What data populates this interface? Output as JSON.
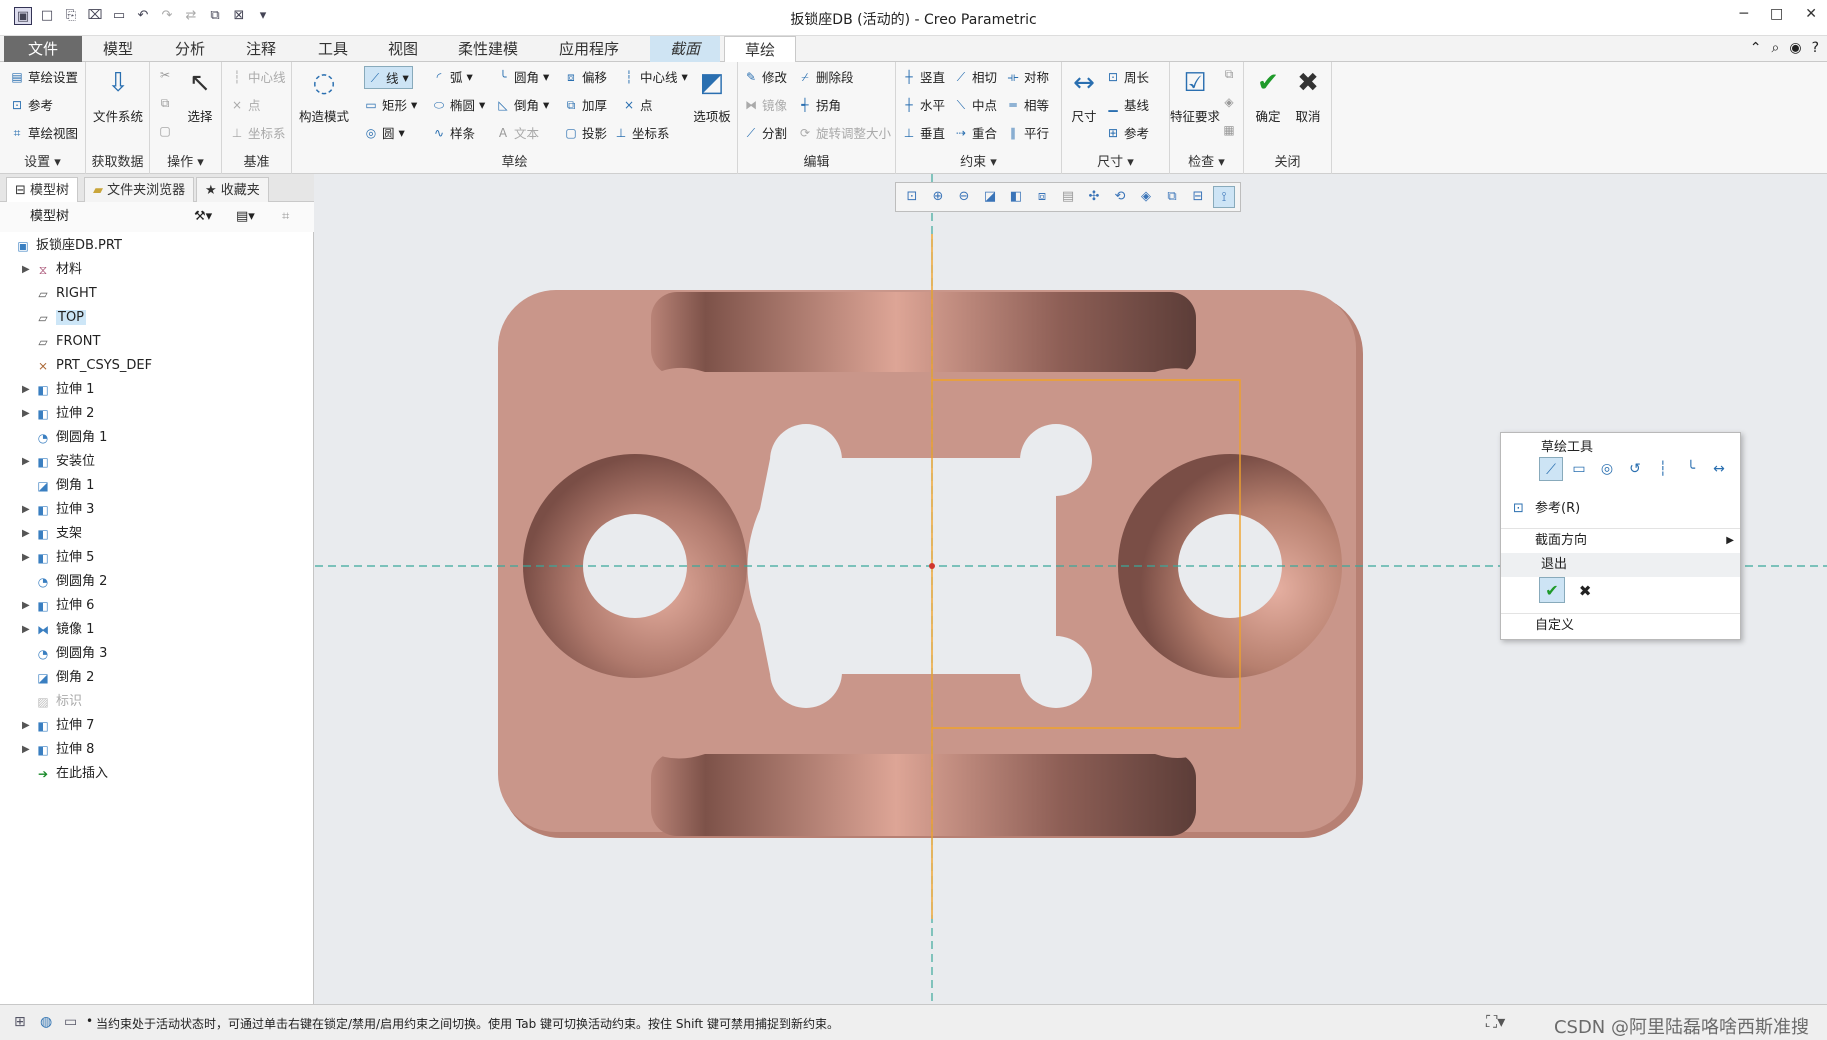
{
  "window": {
    "title": "扳锁座DB (活动的) - Creo Parametric"
  },
  "qat_icons": [
    "app-icon",
    "new-icon",
    "open-icon",
    "save-icon",
    "undo-icon",
    "redo-icon",
    "regenerate-icon",
    "windows-icon",
    "close-icon",
    "customize-icon"
  ],
  "tabs": [
    {
      "label": "文件"
    },
    {
      "label": "模型"
    },
    {
      "label": "分析"
    },
    {
      "label": "注释"
    },
    {
      "label": "工具"
    },
    {
      "label": "视图"
    },
    {
      "label": "柔性建模"
    },
    {
      "label": "应用程序"
    },
    {
      "label": "截面"
    },
    {
      "label": "草绘"
    }
  ],
  "ribbon": {
    "setup": {
      "sketch_setup": "草绘设置",
      "reference": "参考",
      "sketch_view": "草绘视图",
      "label": "设置"
    },
    "get_data": {
      "file_system": "文件系统",
      "label": "获取数据"
    },
    "operations": {
      "select": "选择",
      "label": "操作"
    },
    "datum": {
      "centerline": "中心线",
      "point": "点",
      "csys": "坐标系",
      "label": "基准"
    },
    "sketching": {
      "construction": "构造模式",
      "line": "线",
      "arc": "弧",
      "fillet": "圆角",
      "offset": "偏移",
      "centerline": "中心线",
      "rectangle": "矩形",
      "ellipse": "椭圆",
      "chamfer": "倒角",
      "thicken": "加厚",
      "point": "点",
      "circle": "圆",
      "spline": "样条",
      "text": "文本",
      "project": "投影",
      "csys": "坐标系",
      "palette": "选项板",
      "label": "草绘"
    },
    "editing": {
      "modify": "修改",
      "delete_segment": "删除段",
      "mirror": "镜像",
      "corner": "拐角",
      "divide": "分割",
      "rotate_resize": "旋转调整大小",
      "label": "编辑"
    },
    "constrain": {
      "vertical": "竖直",
      "tangent": "相切",
      "symmetric": "对称",
      "horizontal": "水平",
      "midpoint": "中点",
      "equal": "相等",
      "perpendicular": "垂直",
      "coincident": "重合",
      "parallel": "平行",
      "label": "约束"
    },
    "dimension": {
      "dimension": "尺寸",
      "perimeter": "周长",
      "baseline": "基线",
      "reference": "参考",
      "label": "尺寸"
    },
    "inspect": {
      "feature_req": "特征要求",
      "label": "检查"
    },
    "close": {
      "ok": "确定",
      "cancel": "取消",
      "label": "关闭"
    }
  },
  "panel": {
    "tabs": [
      {
        "label": "模型树"
      },
      {
        "label": "文件夹浏览器"
      },
      {
        "label": "收藏夹"
      }
    ],
    "tree_header": "模型树",
    "items": [
      {
        "label": "扳锁座DB.PRT"
      },
      {
        "label": "材料"
      },
      {
        "label": "RIGHT"
      },
      {
        "label": "TOP"
      },
      {
        "label": "FRONT"
      },
      {
        "label": "PRT_CSYS_DEF"
      },
      {
        "label": "拉伸 1"
      },
      {
        "label": "拉伸 2"
      },
      {
        "label": "倒圆角 1"
      },
      {
        "label": "安装位"
      },
      {
        "label": "倒角 1"
      },
      {
        "label": "拉伸 3"
      },
      {
        "label": "支架"
      },
      {
        "label": "拉伸 5"
      },
      {
        "label": "倒圆角 2"
      },
      {
        "label": "拉伸 6"
      },
      {
        "label": "镜像 1"
      },
      {
        "label": "倒圆角 3"
      },
      {
        "label": "倒角 2"
      },
      {
        "label": "标识"
      },
      {
        "label": "拉伸 7"
      },
      {
        "label": "拉伸 8"
      },
      {
        "label": "在此插入"
      }
    ]
  },
  "context_menu": {
    "header": "草绘工具",
    "reference": "参考(R)",
    "section_orientation": "截面方向",
    "exit": "退出",
    "customize": "自定义"
  },
  "status": {
    "message": "当约束处于活动状态时，可通过单击右键在锁定/禁用/启用约束之间切换。使用 Tab 键可切换活动约束。按住 Shift 键可禁用捕捉到新约束。",
    "watermark": "CSDN @阿里陆磊咯啥西斯准搜"
  },
  "colors": {
    "accent": "#2a6fb0",
    "part": "#c9968a",
    "sketch_line": "#f0a22a",
    "axis": "#3aa89a"
  }
}
